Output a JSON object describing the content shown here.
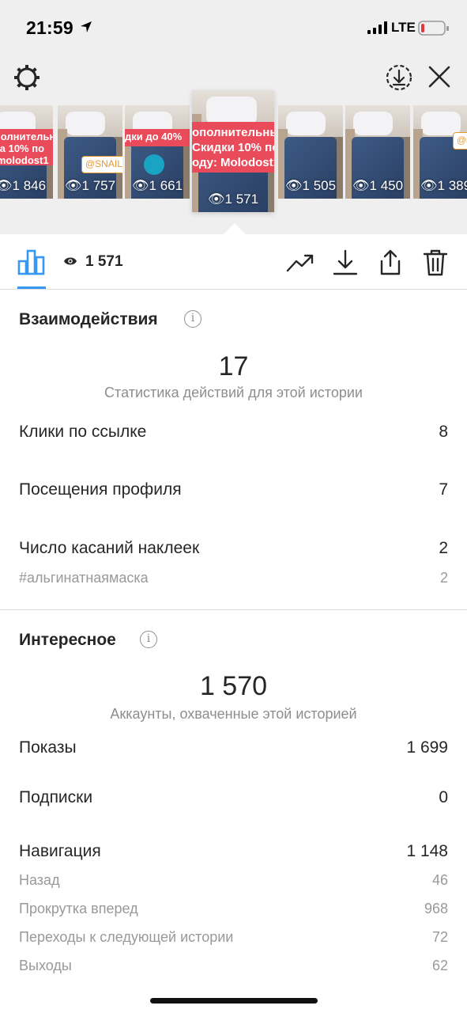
{
  "status_bar": {
    "time": "21:59",
    "network": "LTE"
  },
  "stories": [
    {
      "views": "1 846",
      "banner": "ополнительная\nдка 10% по\ny molodost1",
      "sticker": ""
    },
    {
      "views": "1 757",
      "banner": "",
      "sticker": "@SNAIL_S"
    },
    {
      "views": "1 661",
      "banner": "дки до 40%",
      "sticker": ""
    },
    {
      "views": "1 571",
      "banner": "ополнительные\nСкидки 10% по\nоду: Molodost1",
      "sticker": ""
    },
    {
      "views": "1 505",
      "banner": "",
      "sticker": ""
    },
    {
      "views": "1 450",
      "banner": "",
      "sticker": ""
    },
    {
      "views": "1 389",
      "banner": "",
      "sticker": "@s"
    }
  ],
  "toolbar": {
    "views": "1 571"
  },
  "interactions": {
    "title": "Взаимодействия",
    "total": "17",
    "caption": "Статистика действий для этой истории",
    "rows": [
      {
        "label": "Клики по ссылке",
        "value": "8"
      },
      {
        "label": "Посещения профиля",
        "value": "7"
      },
      {
        "label": "Число касаний наклеек",
        "value": "2"
      }
    ],
    "sub_rows": [
      {
        "label": "#альгинатнаямаска",
        "value": "2"
      }
    ]
  },
  "discovery": {
    "title": "Интересное",
    "total": "1 570",
    "caption": "Аккаунты, охваченные этой историей",
    "rows": [
      {
        "label": "Показы",
        "value": "1 699"
      },
      {
        "label": "Подписки",
        "value": "0"
      },
      {
        "label": "Навигация",
        "value": "1 148"
      }
    ],
    "sub_rows": [
      {
        "label": "Назад",
        "value": "46"
      },
      {
        "label": "Прокрутка вперед",
        "value": "968"
      },
      {
        "label": "Переходы к следующей истории",
        "value": "72"
      },
      {
        "label": "Выходы",
        "value": "62"
      }
    ]
  },
  "colors": {
    "accent": "#3897f0",
    "banner": "#ea4b5a",
    "muted": "#8e8e8e"
  }
}
